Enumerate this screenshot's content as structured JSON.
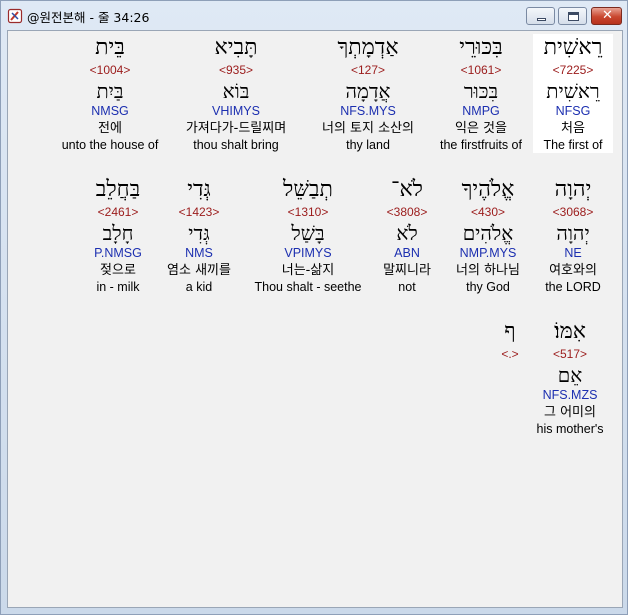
{
  "window": {
    "title": "@원전본해 - 줄 34:26",
    "close_glyph": "✕"
  },
  "rows": [
    [
      {
        "hebrew": "רֵאשִׁית",
        "strong": "<7225>",
        "lemma": "רֵאשִׁית",
        "morph": "NFSG",
        "korean": "처음",
        "english": "The first of",
        "selected": true
      },
      {
        "hebrew": "בִּכּוּרֵי",
        "strong": "<1061>",
        "lemma": "בִּכּוּר",
        "morph": "NMPG",
        "korean": "익은 것을",
        "english": "the firstfruits of"
      },
      {
        "hebrew": "אַדְמָתְךָ",
        "strong": "<127>",
        "lemma": "אֲדָמָה",
        "morph": "NFS.MYS",
        "korean": "너의 토지 소산의",
        "english": "thy land"
      },
      {
        "hebrew": "תָּבִיא",
        "strong": "<935>",
        "lemma": "בּוֹא",
        "morph": "VHIMYS",
        "korean": "가져다가-드릴찌며",
        "english": "thou shalt bring"
      },
      {
        "hebrew": "בֵּית",
        "strong": "<1004>",
        "lemma": "בַּיִת",
        "morph": "NMSG",
        "korean": "전에",
        "english": "unto the house of"
      }
    ],
    [
      {
        "hebrew": "יְהוָה",
        "strong": "<3068>",
        "lemma": "יְהוָה",
        "morph": "NE",
        "korean": "여호와의",
        "english": "the LORD"
      },
      {
        "hebrew": "אֱלֹהֶיךָ",
        "strong": "<430>",
        "lemma": "אֱלֹהִים",
        "morph": "NMP.MYS",
        "korean": "너의 하나님",
        "english": "thy God"
      },
      {
        "hebrew": "לֹא־",
        "strong": "<3808>",
        "lemma": "לֹא",
        "morph": "ABN",
        "korean": "말찌니라",
        "english": "not"
      },
      {
        "hebrew": "תְבַשֵּׁל",
        "strong": "<1310>",
        "lemma": "בָּשַׁל",
        "morph": "VPIMYS",
        "korean": "너는-삶지",
        "english": "Thou shalt - seethe"
      },
      {
        "hebrew": "גְּדִי",
        "strong": "<1423>",
        "lemma": "גְּדִי",
        "morph": "NMS",
        "korean": "염소 새끼를",
        "english": "a kid"
      },
      {
        "hebrew": "בַּחֲלֵב",
        "strong": "<2461>",
        "lemma": "חָלָב",
        "morph": "P.NMSG",
        "korean": "젖으로",
        "english": "in - milk"
      }
    ],
    [
      {
        "hebrew": "אִמּוֹ׃",
        "strong": "<517>",
        "lemma": "אֵם",
        "morph": "NFS.MZS",
        "korean": "그 어미의",
        "english": "his mother's"
      },
      {
        "hebrew": "ף",
        "strong": "<.>",
        "lemma": "",
        "morph": "",
        "korean": "",
        "english": ""
      }
    ]
  ]
}
